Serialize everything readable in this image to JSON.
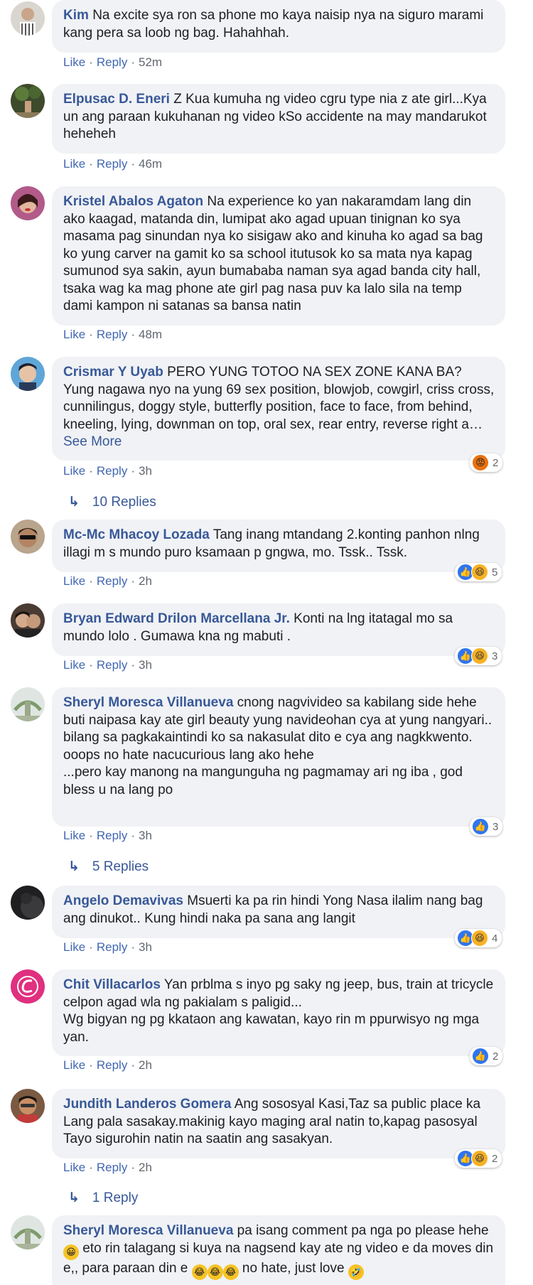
{
  "comments": [
    {
      "author": "Kim",
      "text": "Na excite sya ron sa phone mo kaya naisip nya na siguro marami kang pera sa loob ng bag. Hahahhah.",
      "like": "Like",
      "reply": "Reply",
      "time": "52m"
    },
    {
      "author": "Elpusac D. Eneri",
      "text": "Z Kua kumuha ng video cgru type nia z ate girl...Kya un ang paraan kukuhanan ng video kSo accidente na may mandarukot heheheh",
      "like": "Like",
      "reply": "Reply",
      "time": "46m"
    },
    {
      "author": "Kristel Abalos Agaton",
      "text": "Na experience ko yan nakaramdam lang din ako kaagad, matanda din, lumipat ako agad upuan tinignan ko sya masama pag sinundan nya ko sisigaw ako and kinuha ko agad sa bag ko yung carver na gamit ko sa school itutusok ko sa mata nya kapag sumunod sya sakin, ayun bumababa naman sya agad banda city hall, tsaka wag ka mag phone ate girl pag nasa puv ka lalo sila na temp dami kampon ni satanas sa bansa natin",
      "like": "Like",
      "reply": "Reply",
      "time": "48m"
    },
    {
      "author": "Crismar Y Uyab",
      "text": "PERO YUNG TOTOO NA SEX ZONE KANA BA? Yung nagawa nyo na yung 69 sex position, blowjob, cowgirl, criss cross, cunnilingus, doggy style, butterfly position, face to face, from behind, kneeling, lying, downman on top, oral sex, rear entry, reverse right a…",
      "see_more": "See More",
      "like": "Like",
      "reply": "Reply",
      "time": "3h",
      "reaction_count": "2",
      "replies": "10 Replies"
    },
    {
      "author": "Mc-Mc Mhacoy Lozada",
      "text": "Tang inang mtandang 2.konting panhon nlng illagi m s mundo puro ksamaan p gngwa, mo. Tssk.. Tssk.",
      "like": "Like",
      "reply": "Reply",
      "time": "2h",
      "reaction_count": "5"
    },
    {
      "author": "Bryan Edward Drilon Marcellana Jr.",
      "text": "Konti na lng itatagal mo sa mundo lolo . Gumawa kna ng mabuti .",
      "like": "Like",
      "reply": "Reply",
      "time": "3h",
      "reaction_count": "3"
    },
    {
      "author": "Sheryl Moresca Villanueva",
      "text": "cnong nagvivideo sa kabilang side hehe buti naipasa kay ate girl beauty yung navideohan cya at yung nangyari.. bilang sa pagkakaintindi ko sa nakasulat dito e cya ang nagkkwento.\nooops no hate nacucurious lang ako hehe\n...pero kay manong na mangunguha ng pagmamay ari ng iba , god bless u na lang po",
      "like": "Like",
      "reply": "Reply",
      "time": "3h",
      "reaction_count": "3",
      "replies": "5 Replies"
    },
    {
      "author": "Angelo Demavivas",
      "text": "Msuerti ka pa rin hindi Yong Nasa ilalim nang bag ang dinukot.. Kung hindi naka pa sana ang langit",
      "like": "Like",
      "reply": "Reply",
      "time": "3h",
      "reaction_count": "4"
    },
    {
      "author": "Chit Villacarlos",
      "text": "Yan prblma s inyo pg saky ng jeep, bus, train at tricycle celpon agad wla ng pakialam s paligid...\nWg bigyan ng pg kkataon ang kawatan, kayo rin m ppurwisyo ng mga yan.",
      "like": "Like",
      "reply": "Reply",
      "time": "2h",
      "reaction_count": "2"
    },
    {
      "author": "Jundith Landeros Gomera",
      "text": "Ang sososyal Kasi,Taz sa public place ka Lang pala sasakay.makinig kayo maging aral natin to,kapag pasosyal Tayo sigurohin natin na saatin ang sasakyan.",
      "like": "Like",
      "reply": "Reply",
      "time": "2h",
      "reaction_count": "2",
      "replies": "1 Reply"
    },
    {
      "author": "Sheryl Moresca Villanueva",
      "text_a": "pa isang comment pa nga po please hehe",
      "text_b": " eto rin talagang si kuya na nagsend kay ate ng video e da moves din e,, para paraan din e ",
      "text_c": " no hate, just love "
    }
  ],
  "separator": "·",
  "reply_arrow": "↳",
  "colors": {
    "author": "#385898",
    "bubble": "#f0f2f5",
    "action": "#4267b2",
    "meta": "#606770",
    "like": "#2e75f0",
    "haha": "#f7b125",
    "angry": "#e9710f"
  }
}
